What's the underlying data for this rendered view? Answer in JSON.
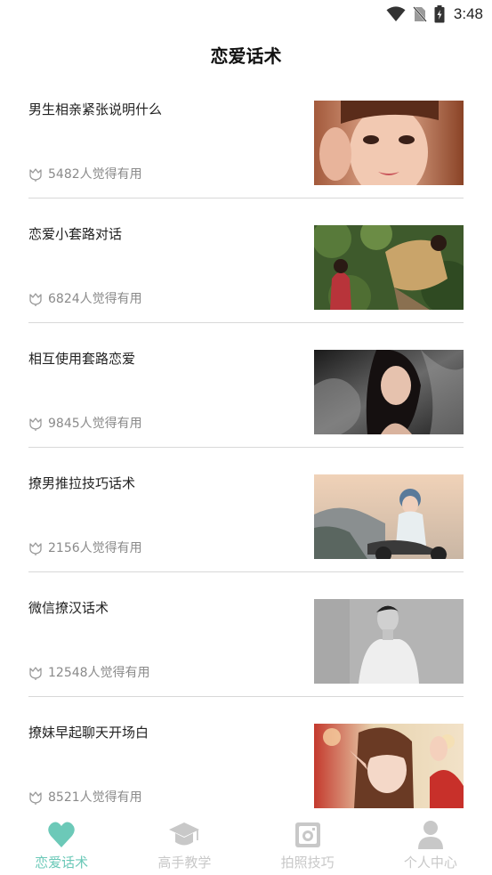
{
  "status": {
    "time": "3:48",
    "icons": [
      "wifi-icon",
      "no-sim-icon",
      "battery-icon"
    ]
  },
  "page": {
    "title": "恋爱话术"
  },
  "items": [
    {
      "title": "男生相亲紧张说明什么",
      "likes": "5482人觉得有用",
      "thumb": "portrait-close-up-thumbnail"
    },
    {
      "title": "恋爱小套路对话",
      "likes": "6824人觉得有用",
      "thumb": "couple-forest-thumbnail"
    },
    {
      "title": "相互使用套路恋爱",
      "likes": "9845人觉得有用",
      "thumb": "woman-dark-fabric-thumbnail"
    },
    {
      "title": "撩男推拉技巧话术",
      "likes": "2156人觉得有用",
      "thumb": "girl-scooter-thumbnail"
    },
    {
      "title": "微信撩汉话术",
      "likes": "12548人觉得有用",
      "thumb": "man-grayscale-thumbnail"
    },
    {
      "title": "撩妹早起聊天开场白",
      "likes": "8521人觉得有用",
      "thumb": "girl-elf-ears-thumbnail"
    }
  ],
  "tabs": [
    {
      "label": "恋爱话术",
      "icon": "heart-icon",
      "active": true
    },
    {
      "label": "高手教学",
      "icon": "graduation-cap-icon",
      "active": false
    },
    {
      "label": "拍照技巧",
      "icon": "camera-icon",
      "active": false
    },
    {
      "label": "个人中心",
      "icon": "person-icon",
      "active": false
    }
  ],
  "colors": {
    "accent": "#6cc9b8",
    "inactive": "#c8c8c8",
    "divider": "#d8d8d8",
    "secondary_text": "#8a8a8a"
  }
}
